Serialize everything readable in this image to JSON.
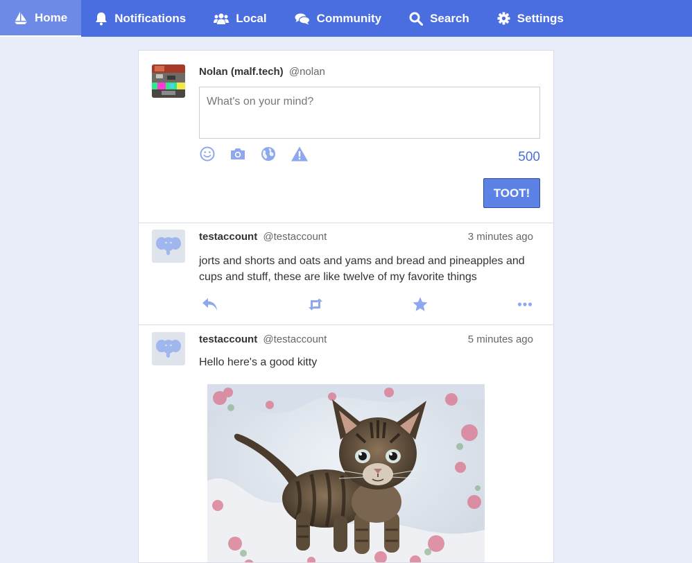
{
  "nav": {
    "items": [
      {
        "label": "Home",
        "icon": "sailboat-icon"
      },
      {
        "label": "Notifications",
        "icon": "bell-icon"
      },
      {
        "label": "Local",
        "icon": "users-icon"
      },
      {
        "label": "Community",
        "icon": "comments-icon"
      },
      {
        "label": "Search",
        "icon": "search-icon"
      },
      {
        "label": "Settings",
        "icon": "gear-icon"
      }
    ],
    "active": "Home"
  },
  "compose": {
    "display_name": "Nolan (malf.tech)",
    "handle": "@nolan",
    "placeholder": "What's on your mind?",
    "value": "",
    "tools": [
      "emoji-icon",
      "camera-icon",
      "globe-icon",
      "warning-icon"
    ],
    "char_count": "500",
    "submit_label": "TOOT!"
  },
  "statuses": [
    {
      "display_name": "testaccount",
      "handle": "@testaccount",
      "time": "3 minutes ago",
      "text": "jorts and shorts and oats and yams and bread and pineapples and cups and stuff, these are like twelve of my favorite things",
      "actions": [
        "reply-icon",
        "boost-icon",
        "favorite-icon",
        "more-icon"
      ]
    },
    {
      "display_name": "testaccount",
      "handle": "@testaccount",
      "time": "5 minutes ago",
      "text": "Hello here's a good kitty",
      "media": "kitten-photo"
    }
  ],
  "colors": {
    "nav_bg": "#4a6ee0",
    "nav_active": "#6c8ae6",
    "page_bg": "#e9edf9",
    "accent": "#4a6ee0",
    "icon": "#8ea8ee"
  }
}
